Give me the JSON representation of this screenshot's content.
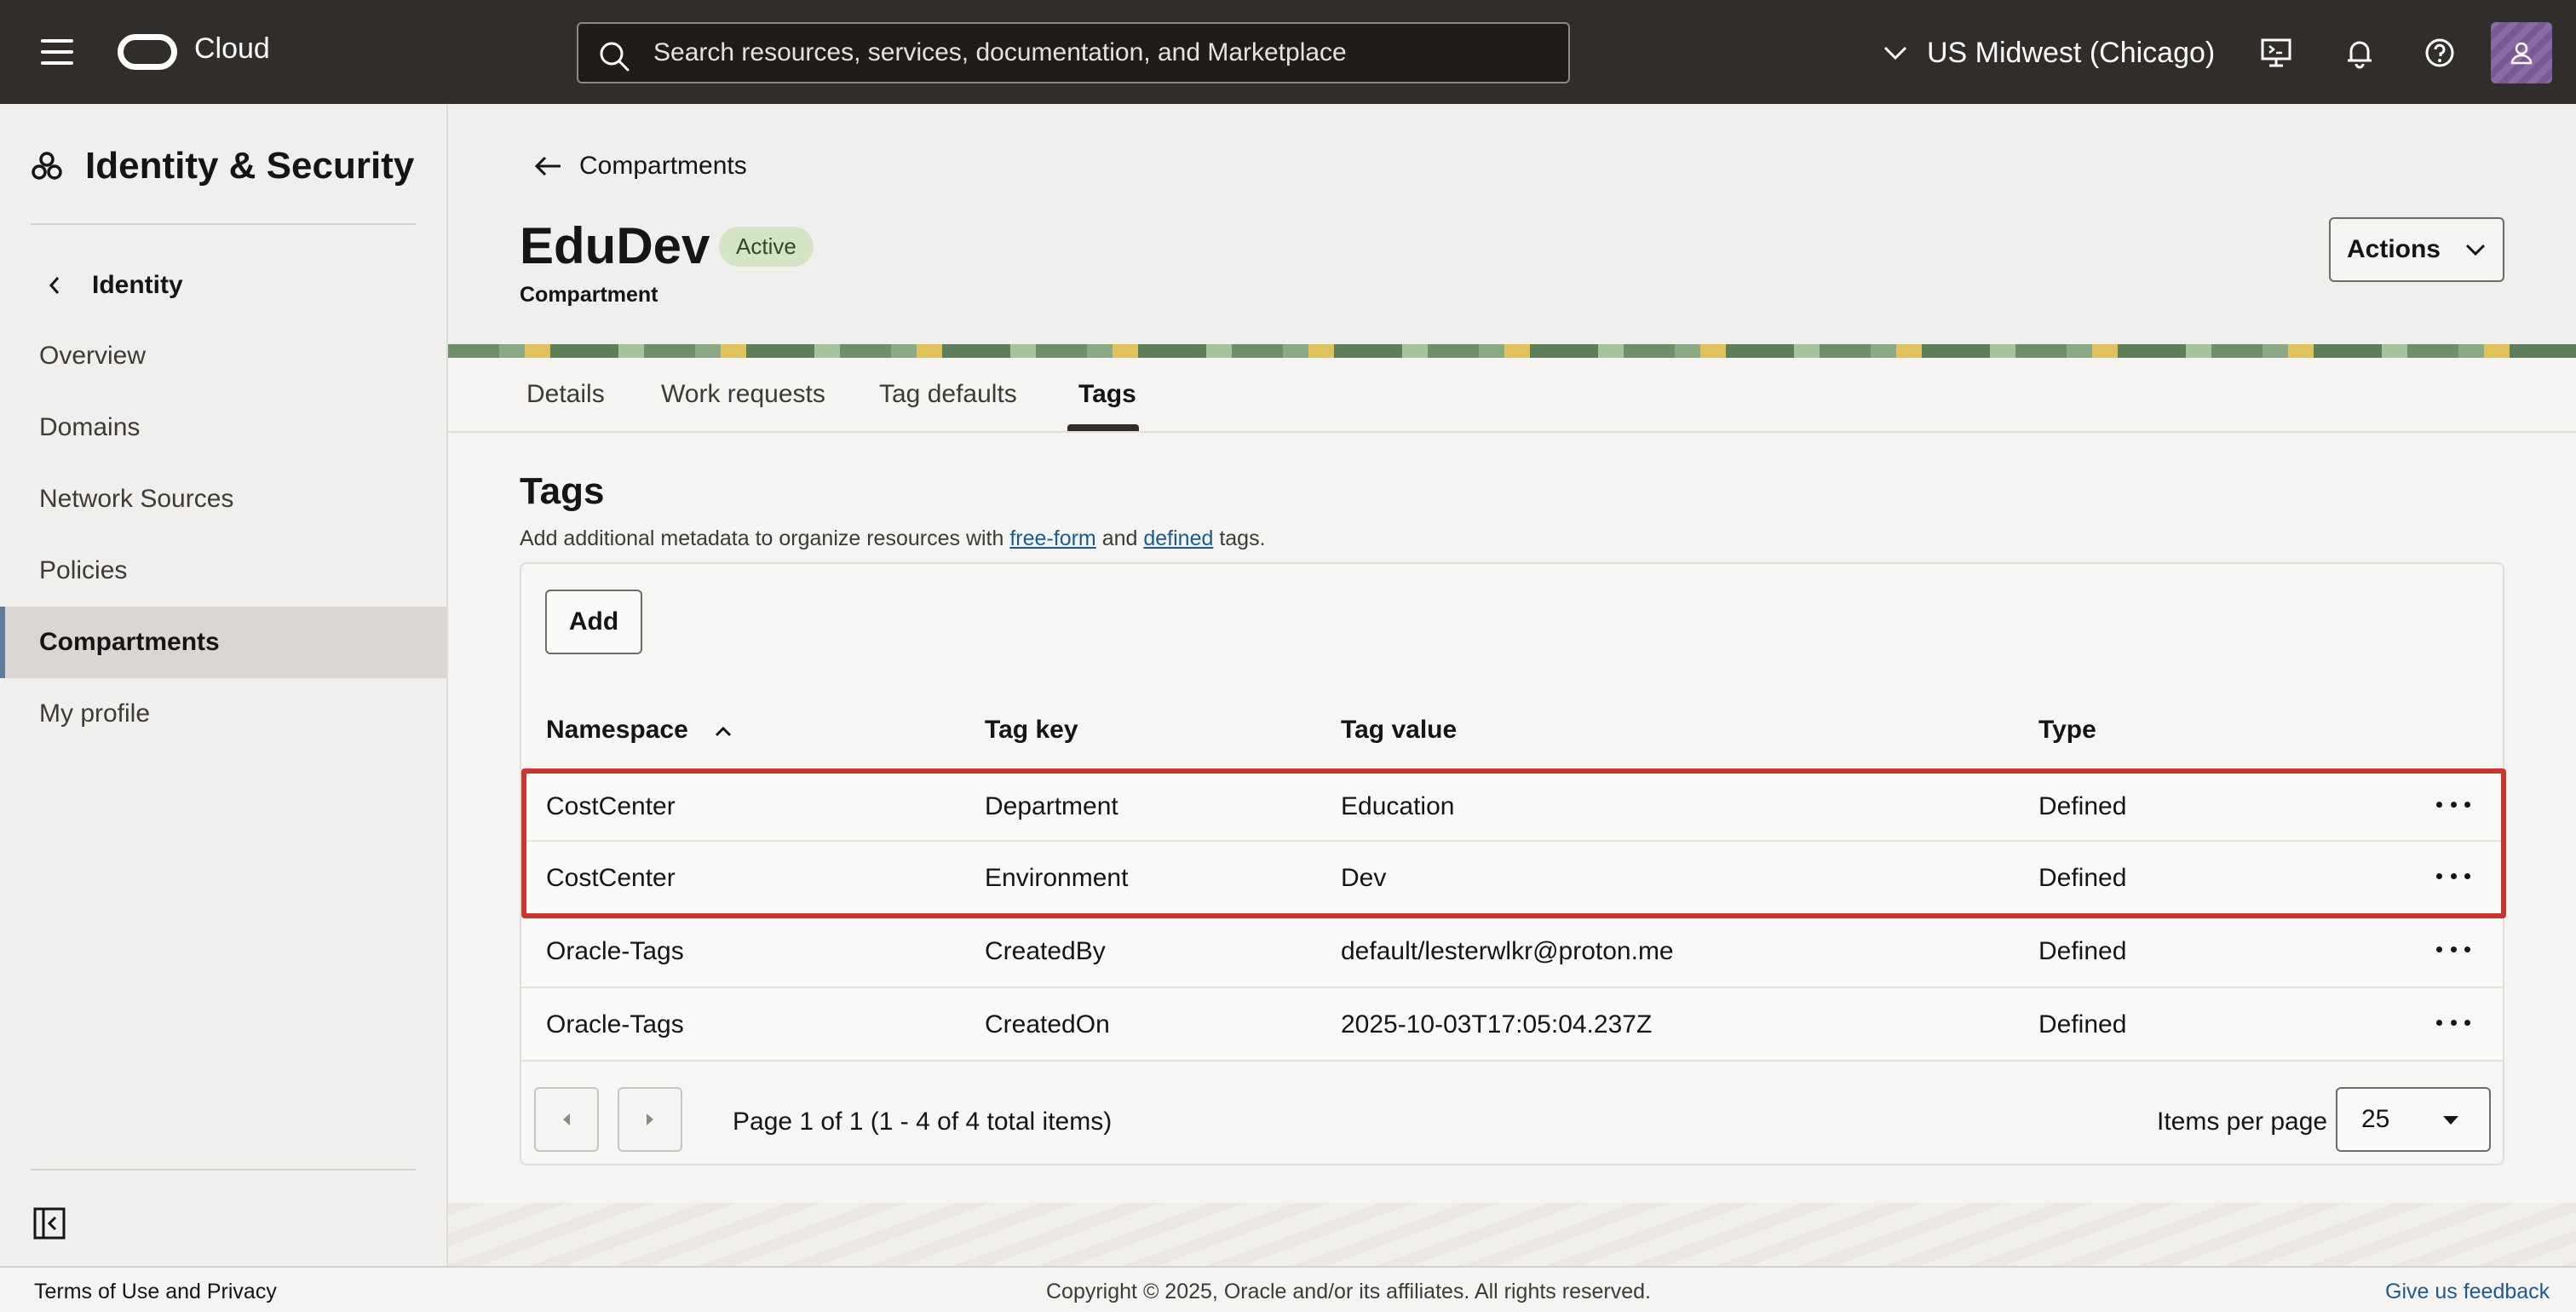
{
  "topbar": {
    "brand": "Cloud",
    "search_placeholder": "Search resources, services, documentation, and Marketplace",
    "region": "US Midwest (Chicago)"
  },
  "sidebar": {
    "title": "Identity & Security",
    "back_label": "Identity",
    "items": [
      {
        "label": "Overview"
      },
      {
        "label": "Domains"
      },
      {
        "label": "Network Sources"
      },
      {
        "label": "Policies"
      },
      {
        "label": "Compartments",
        "active": true
      },
      {
        "label": "My profile"
      }
    ]
  },
  "header": {
    "breadcrumb": "Compartments",
    "title": "EduDev",
    "status": "Active",
    "subtitle": "Compartment",
    "actions_label": "Actions"
  },
  "tabs": [
    {
      "label": "Details"
    },
    {
      "label": "Work requests"
    },
    {
      "label": "Tag defaults"
    },
    {
      "label": "Tags",
      "active": true
    }
  ],
  "tags_section": {
    "title": "Tags",
    "desc_prefix": "Add additional metadata to organize resources with ",
    "link_freeform": "free-form",
    "desc_and": " and ",
    "link_defined": "defined",
    "desc_suffix": " tags.",
    "add_label": "Add",
    "columns": [
      "Namespace",
      "Tag key",
      "Tag value",
      "Type"
    ],
    "rows": [
      {
        "namespace": "CostCenter",
        "key": "Department",
        "value": "Education",
        "type": "Defined"
      },
      {
        "namespace": "CostCenter",
        "key": "Environment",
        "value": "Dev",
        "type": "Defined"
      },
      {
        "namespace": "Oracle-Tags",
        "key": "CreatedBy",
        "value": "default/lesterwlkr@proton.me",
        "type": "Defined"
      },
      {
        "namespace": "Oracle-Tags",
        "key": "CreatedOn",
        "value": "2025-10-03T17:05:04.237Z",
        "type": "Defined"
      }
    ],
    "pagination_text": "Page 1 of 1 (1 - 4 of 4 total items)",
    "items_per_page_label": "Items per page",
    "items_per_page_value": "25"
  },
  "footer": {
    "terms": "Terms of Use and Privacy",
    "copyright": "Copyright © 2025, Oracle and/or its affiliates. All rights reserved.",
    "feedback": "Give us feedback"
  },
  "colors": {
    "topbar": "#312d2a",
    "accent_link": "#1a5c8f",
    "highlight_border": "#c9362e",
    "status_badge_bg": "#d4e5c6"
  }
}
